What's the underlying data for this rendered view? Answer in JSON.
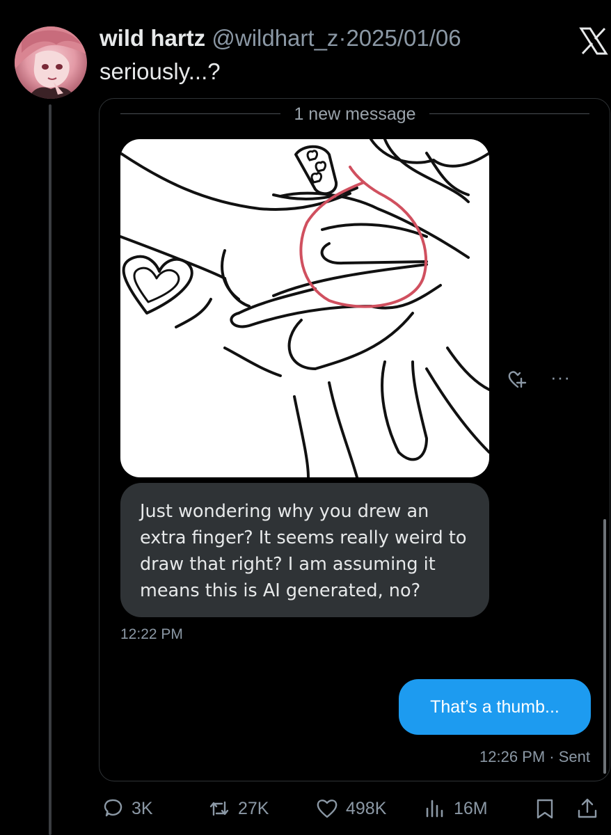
{
  "author": {
    "name": "wild hartz",
    "handle": "@wildhart_z",
    "separator": "·",
    "date": "2025/01/06"
  },
  "tweet_text": "seriously...?",
  "dm": {
    "divider_label": "1 new message",
    "incoming_message": "Just wondering why you drew an extra finger? It seems really weird to draw that right? I am assuming it means this is AI generated, no?",
    "incoming_time": "12:22 PM",
    "outgoing_message": "That’s a thumb...",
    "outgoing_time": "12:26 PM · Sent",
    "more_glyph": "···"
  },
  "actions": {
    "replies": "3K",
    "reposts": "27K",
    "likes": "498K",
    "views": "16M"
  },
  "colors": {
    "background": "#000000",
    "accent_blue": "#1d9bf0",
    "bubble_gray": "#2f3336",
    "annotation_red": "#d0505f"
  },
  "icons": [
    "x-logo-icon",
    "react-heart-plus-icon",
    "more-icon",
    "reply-icon",
    "repost-icon",
    "like-icon",
    "views-icon",
    "bookmark-icon",
    "share-icon"
  ]
}
